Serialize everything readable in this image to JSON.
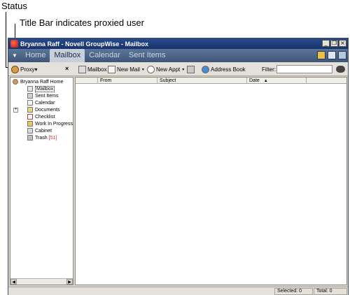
{
  "callouts": {
    "status": "Status",
    "title_bar": "Title Bar indicates proxied user"
  },
  "window": {
    "title": "Bryanna Raff - Novell GroupWise - Mailbox",
    "controls": {
      "minimize": "_",
      "restore": "❒",
      "close": "×"
    }
  },
  "nav": {
    "arrow": "▼",
    "tabs": [
      {
        "label": "Home",
        "active": false
      },
      {
        "label": "Mailbox",
        "active": true
      },
      {
        "label": "Calendar",
        "active": false
      },
      {
        "label": "Sent Items",
        "active": false
      }
    ]
  },
  "toolbar": {
    "proxy_label": "Proxy",
    "proxy_dropdown": "▾",
    "close_pane": "×",
    "mailbox_label": "Mailbox",
    "new_mail_label": "New Mail",
    "new_appt_label": "New Appt",
    "address_book_label": "Address Book",
    "filter_label": "Filter:",
    "filter_value": "",
    "dropdown_glyph": "▾"
  },
  "folders": {
    "home": "Bryanna Raff Home",
    "expand_glyph": "+",
    "items": [
      {
        "label": "Mailbox"
      },
      {
        "label": "Sent Items"
      },
      {
        "label": "Calendar"
      },
      {
        "label": "Documents"
      },
      {
        "label": "Checklist"
      },
      {
        "label": "Work In Progress"
      },
      {
        "label": "Cabinet"
      },
      {
        "label": "Trash"
      }
    ],
    "trash_count": "[51]"
  },
  "scroll": {
    "left": "◀",
    "right": "▶"
  },
  "list": {
    "columns": [
      "From",
      "Subject",
      "Date",
      "▲"
    ]
  },
  "status_bar": {
    "selected": "Selected: 0",
    "total": "Total: 0"
  },
  "colors": {
    "titlebar": "#17336c",
    "navbar": "#4c6486",
    "active_tab": "#c6cfdb",
    "trash_count": "#c0392b"
  }
}
